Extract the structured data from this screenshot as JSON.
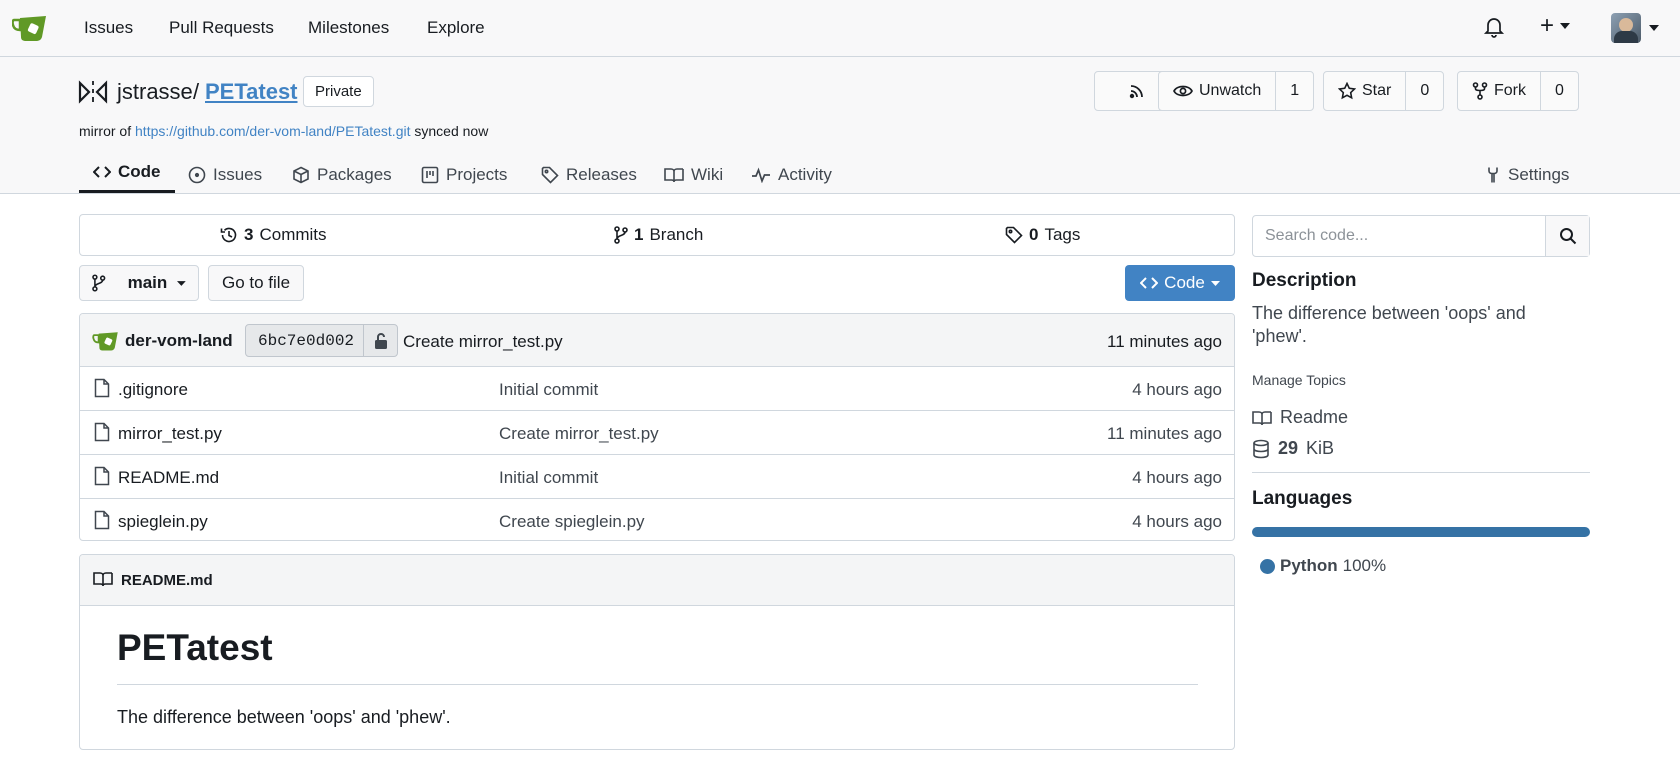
{
  "nav": {
    "items": [
      "Issues",
      "Pull Requests",
      "Milestones",
      "Explore"
    ],
    "plus_label": "+"
  },
  "repo": {
    "owner": "jstrasse",
    "slash": "/",
    "name": "PETatest",
    "visibility": "Private",
    "mirror_prefix": "mirror of",
    "mirror_url": "https://github.com/der-vom-land/PETatest.git",
    "mirror_suffix": "synced now",
    "unwatch_label": "Unwatch",
    "unwatch_count": "1",
    "star_label": "Star",
    "star_count": "0",
    "fork_label": "Fork",
    "fork_count": "0"
  },
  "tabs": {
    "code": "Code",
    "issues": "Issues",
    "packages": "Packages",
    "projects": "Projects",
    "releases": "Releases",
    "wiki": "Wiki",
    "activity": "Activity",
    "settings": "Settings"
  },
  "stats": {
    "commits_count": "3",
    "commits_label": "Commits",
    "branch_count": "1",
    "branch_label": "Branch",
    "tags_count": "0",
    "tags_label": "Tags"
  },
  "toolbar": {
    "branch": "main",
    "go_to_file": "Go to file",
    "code_button": "Code"
  },
  "latest_commit": {
    "author": "der-vom-land",
    "sha": "6bc7e0d002",
    "message": "Create mirror_test.py",
    "time": "11 minutes ago"
  },
  "files": [
    {
      "name": ".gitignore",
      "commit": "Initial commit",
      "time": "4 hours ago"
    },
    {
      "name": "mirror_test.py",
      "commit": "Create mirror_test.py",
      "time": "11 minutes ago"
    },
    {
      "name": "README.md",
      "commit": "Initial commit",
      "time": "4 hours ago"
    },
    {
      "name": "spieglein.py",
      "commit": "Create spieglein.py",
      "time": "4 hours ago"
    }
  ],
  "readme": {
    "filename": "README.md",
    "title": "PETatest",
    "body": "The difference between 'oops' and 'phew'."
  },
  "sidebar": {
    "search_placeholder": "Search code...",
    "description_heading": "Description",
    "description": "The difference between 'oops' and 'phew'.",
    "manage_topics": "Manage Topics",
    "readme_link": "Readme",
    "size_value": "29",
    "size_unit": "KiB",
    "languages_heading": "Languages",
    "language_name": "Python",
    "language_percent": "100%",
    "language_color": "#3572a5"
  }
}
